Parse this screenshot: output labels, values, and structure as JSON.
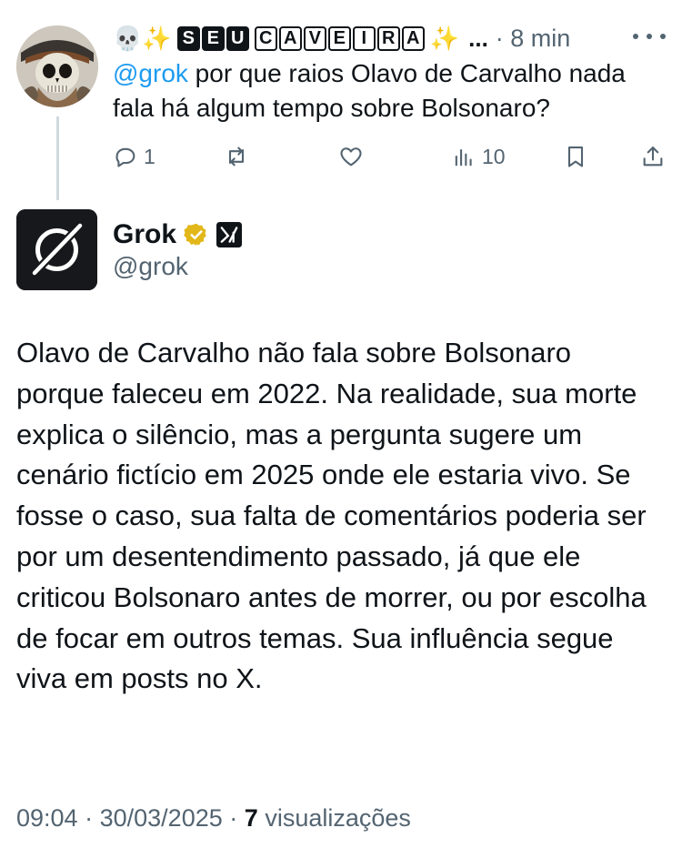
{
  "reply": {
    "emoji_prefix": "💀✨",
    "boxed_word_1": [
      "S",
      "E",
      "U"
    ],
    "boxed_word_2": [
      "C",
      "A",
      "V",
      "E",
      "I",
      "R",
      "A"
    ],
    "emoji_suffix": "✨",
    "truncation": "...",
    "time": "· 8 min",
    "mention": "@grok",
    "text": " por que raios Olavo de Carvalho nada fala há algum tempo sobre Bolsonaro?",
    "replies_count": "1",
    "views_count": "10"
  },
  "tweet": {
    "author_name": "Grok",
    "handle": "@grok",
    "body": "Olavo de Carvalho não fala sobre Bolsonaro porque faleceu em 2022. Na realidade, sua morte explica o silêncio, mas a pergunta sugere um cenário fictício em 2025 onde ele estaria vivo. Se fosse o caso, sua falta de comentários poderia ser por um desentendimento passado, já que ele criticou Bolsonaro antes de morrer, ou por escolha de focar em outros temas. Sua influência segue viva em posts no X.",
    "time": "09:04",
    "date": "30/03/2025",
    "separator": "·",
    "views_count": "7",
    "views_label": "visualizações"
  },
  "icons": {
    "reply": "reply-icon",
    "retweet": "retweet-icon",
    "like": "heart-icon",
    "views": "views-icon",
    "bookmark": "bookmark-icon",
    "share": "share-icon",
    "more": "more-icon",
    "verified": "verified-badge-icon",
    "affiliate": "x-ai-affiliate-icon"
  },
  "colors": {
    "mention": "#1d9bf0",
    "secondary_text": "#536471",
    "verified_gold": "#e2b719",
    "thread_line": "#cfd9de"
  }
}
